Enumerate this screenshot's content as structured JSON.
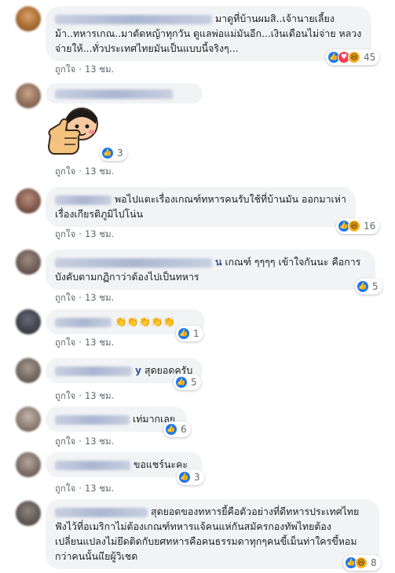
{
  "comments": [
    {
      "text": "มาดูที่บ้านผมสิ..เจ้านายเลี้ยงม้า..ทหารเกณ..มาตัดหญ้าทุกวัน ดูแลพ่อแม่มันอีก...เงินเดือนไม่จ่าย หลวงจ่ายให้...ทั่วประเทศไทยมันเป็นแบบนี้จริงๆ...",
      "reactions": "45",
      "like": "ถูกใจ",
      "time": "13 ชม."
    },
    {
      "text": "",
      "reactions": "3",
      "like": "ถูกใจ",
      "time": "13 ชม."
    },
    {
      "name_tail": "",
      "text": "พอไปแตะเรื่องเกณฑ์ทหารคนรับใช้ที่บ้านมัน ออกมาเห่าเรื่องเกียรติภูมิไปโน่น",
      "reactions": "16",
      "like": "ถูกใจ",
      "time": "13 ชม."
    },
    {
      "name_tail": "น",
      "text": "เกณฑ์ ๆๆๆๆ เข้าใจกันนะ คือการบังคับตามกฏิกาว่าต้องไปเป็นทหาร",
      "reactions": "5",
      "like": "ถูกใจ",
      "time": "13 ชม."
    },
    {
      "text": "👏👏👏👏👏",
      "reactions": "1",
      "like": "ถูกใจ",
      "time": "13 ชม."
    },
    {
      "name_tail": "y",
      "text": "สุดยอดครับ",
      "reactions": "5",
      "like": "ถูกใจ",
      "time": "13 ชม."
    },
    {
      "text": "เท่มากเลย",
      "reactions": "6",
      "like": "ถูกใจ",
      "time": "13 ชม."
    },
    {
      "text": "ขอแชร์นะคะ",
      "reactions": "3",
      "like": "ถูกใจ",
      "time": "13 ชม."
    },
    {
      "text": "สุดยอดของทหารยี้คือตัวอย่างที่ดีทหารประเทศไทยฟังไว้ที่อเมริกาไม่ต้องเกณฑ์ทหารแจ้คนแห่กันสมัครกองทัพไทยต้องเปลี่ยนแปลงไม่ยึดติดกับยศทหารคือคนธรรมดาทุกๆคนขี้เม็นท่าใครขึ้หอมกว่าคนนั้นแียผู้วิเชด",
      "reactions": "8"
    }
  ]
}
